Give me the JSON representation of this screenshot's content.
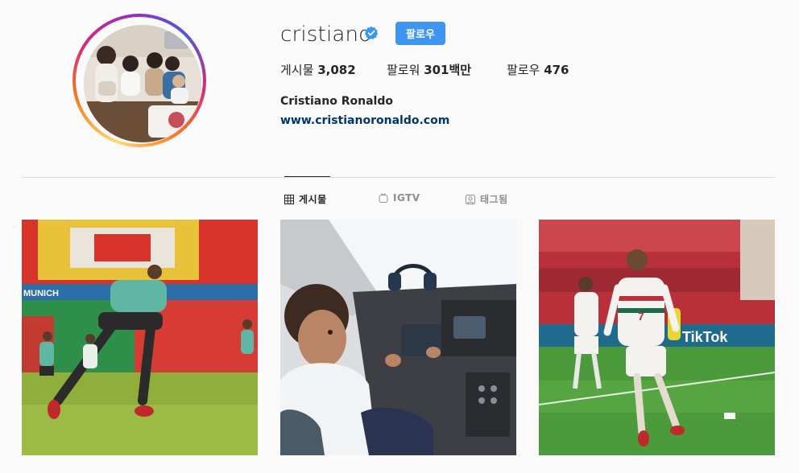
{
  "profile": {
    "username": "cristiano",
    "follow_label": "팔로우",
    "stats": {
      "posts_label": "게시물",
      "posts_value": "3,082",
      "followers_label": "팔로워",
      "followers_value": "301백만",
      "following_label": "팔로우",
      "following_value": "476"
    },
    "full_name": "Cristiano Ronaldo",
    "website": "www.cristianoronaldo.com"
  },
  "tabs": [
    {
      "label": "게시물",
      "icon": "grid-icon",
      "active": true
    },
    {
      "label": "IGTV",
      "icon": "igtv-icon",
      "active": false
    },
    {
      "label": "태그됨",
      "icon": "tagged-icon",
      "active": false
    }
  ],
  "posts": {
    "post1_sign": "MUNICH",
    "post3_sign": "TikTok",
    "post3_jersey_number": "7"
  },
  "colors": {
    "accent": "#3f96f0",
    "link": "#00376b",
    "verified": "#3897f0"
  }
}
